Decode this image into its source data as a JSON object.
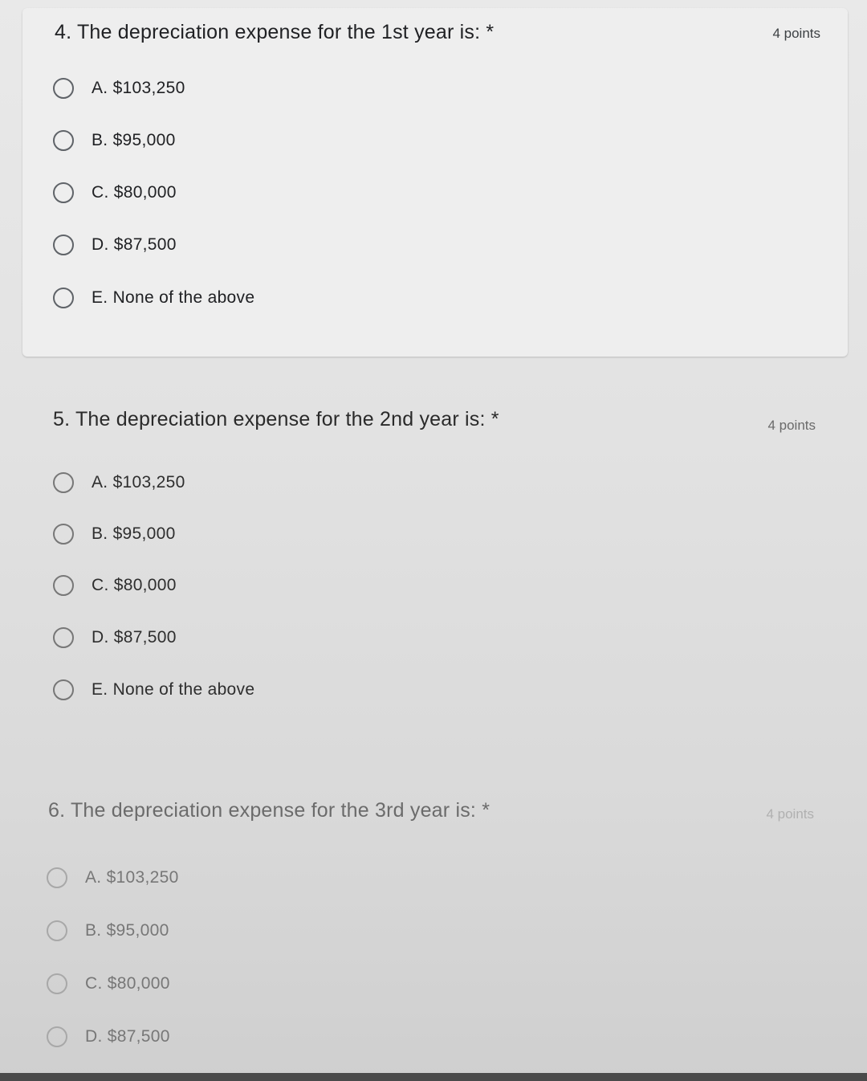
{
  "questions": [
    {
      "title": "4. The depreciation expense for the 1st year is: *",
      "points": "4 points",
      "options": [
        "A. $103,250",
        "B. $95,000",
        "C. $80,000",
        "D. $87,500",
        "E. None of the above"
      ]
    },
    {
      "title": "5. The depreciation expense for the 2nd year is: *",
      "points": "4 points",
      "options": [
        "A. $103,250",
        "B. $95,000",
        "C. $80,000",
        "D. $87,500",
        "E. None of the above"
      ]
    },
    {
      "title": "6. The depreciation expense for the 3rd year is: *",
      "points": "4 points",
      "options": [
        "A. $103,250",
        "B. $95,000",
        "C. $80,000",
        "D. $87,500"
      ]
    }
  ]
}
